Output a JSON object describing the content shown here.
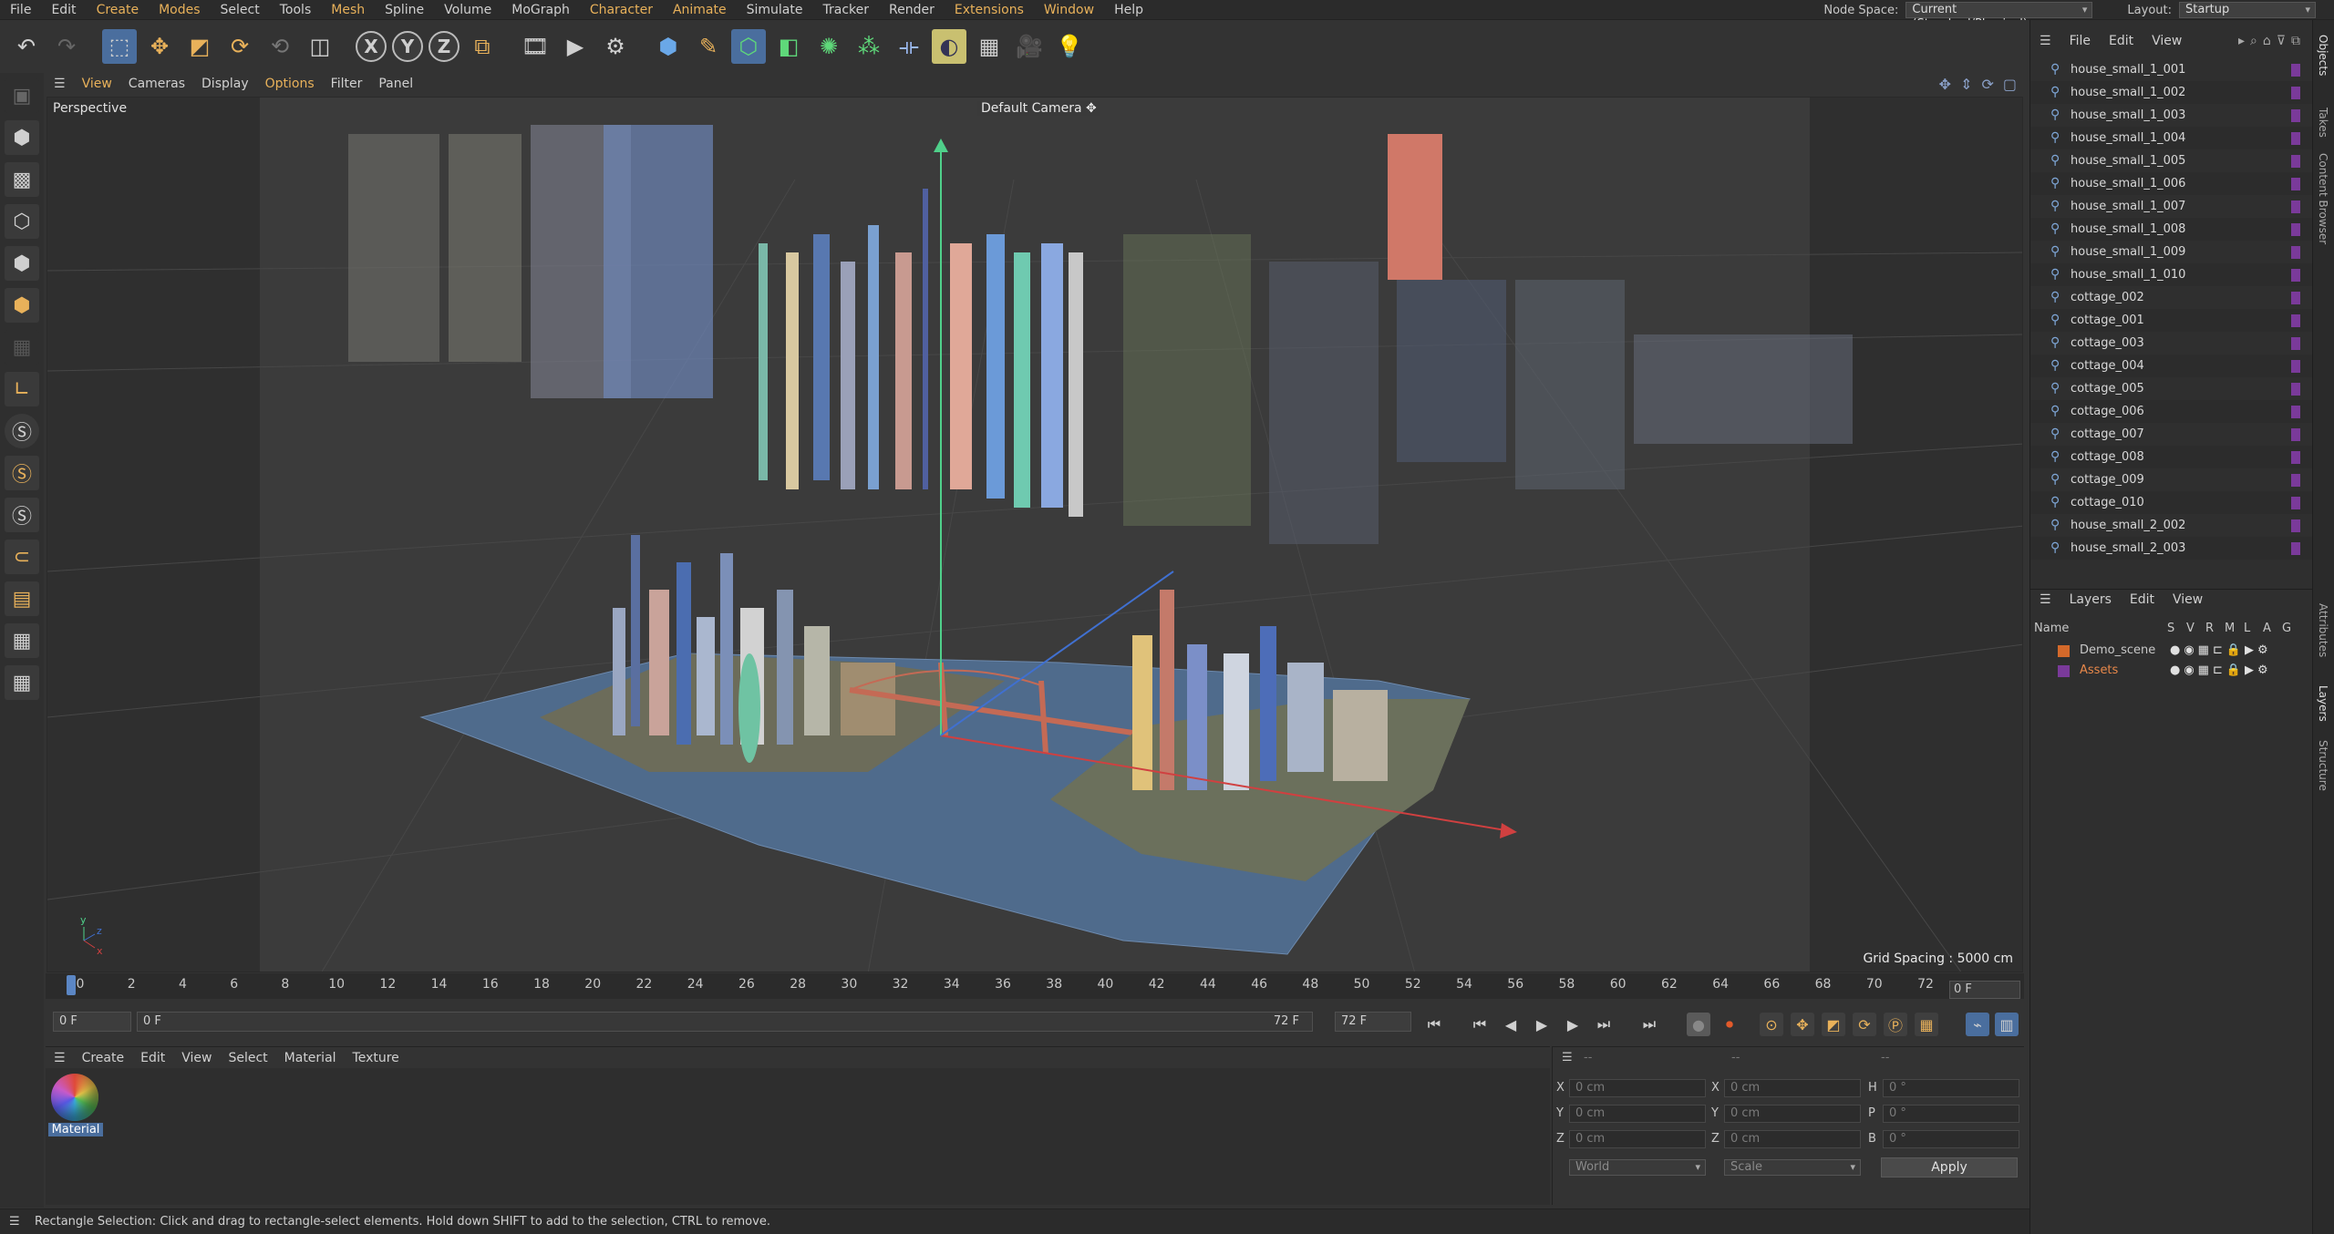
{
  "menubar": {
    "items": [
      "File",
      "Edit",
      "Create",
      "Modes",
      "Select",
      "Tools",
      "Mesh",
      "Spline",
      "Volume",
      "MoGraph",
      "Character",
      "Animate",
      "Simulate",
      "Tracker",
      "Render",
      "Extensions",
      "Window",
      "Help"
    ],
    "node_space_label": "Node Space:",
    "node_space_value": "Current (Standard/Physical)",
    "layout_label": "Layout:",
    "layout_value": "Startup"
  },
  "toolbar": {
    "icons": [
      "undo-icon",
      "redo-icon",
      "rectangle-select-icon",
      "move-icon",
      "scale-icon",
      "rotate-icon",
      "recent-tools-icon",
      "live-selection-icon",
      "x-axis-icon",
      "y-axis-icon",
      "z-axis-icon",
      "coordinate-system-icon",
      "render-region-icon",
      "render-view-icon",
      "render-settings-icon",
      "cube-icon",
      "pen-icon",
      "subdivision-icon",
      "extrude-icon",
      "cloner-icon",
      "array-icon",
      "deformer-icon",
      "field-icon",
      "floor-icon",
      "camera-icon",
      "light-icon"
    ],
    "axis_labels": [
      "X",
      "Y",
      "Z"
    ]
  },
  "viewport": {
    "menu": [
      "View",
      "Cameras",
      "Display",
      "Options",
      "Filter",
      "Panel"
    ],
    "label": "Perspective",
    "camera": "Default Camera",
    "grid_spacing": "Grid Spacing : 5000 cm"
  },
  "timeline": {
    "ticks": [
      "0",
      "2",
      "4",
      "6",
      "8",
      "10",
      "12",
      "14",
      "16",
      "18",
      "20",
      "22",
      "24",
      "26",
      "28",
      "30",
      "32",
      "34",
      "36",
      "38",
      "40",
      "42",
      "44",
      "46",
      "48",
      "50",
      "52",
      "54",
      "56",
      "58",
      "60",
      "62",
      "64",
      "66",
      "68",
      "70",
      "72"
    ],
    "frame_display": "0 F"
  },
  "transport": {
    "start_field": "0 F",
    "current_field": "0 F",
    "end_label": "72 F",
    "end_field": "72 F"
  },
  "material_manager": {
    "menu": [
      "Create",
      "Edit",
      "View",
      "Select",
      "Material",
      "Texture"
    ],
    "material_name": "Material"
  },
  "coordinates": {
    "header_left": "--",
    "header_mid": "--",
    "header_right": "--",
    "pos_labels": [
      "X",
      "Y",
      "Z"
    ],
    "pos_values": [
      "0 cm",
      "0 cm",
      "0 cm"
    ],
    "size_labels": [
      "X",
      "Y",
      "Z"
    ],
    "size_values": [
      "0 cm",
      "0 cm",
      "0 cm"
    ],
    "rot_labels": [
      "H",
      "P",
      "B"
    ],
    "rot_values": [
      "0 °",
      "0 °",
      "0 °"
    ],
    "space_select": "World",
    "mode_select": "Scale",
    "apply": "Apply"
  },
  "status": "Rectangle Selection: Click and drag to rectangle-select elements. Hold down SHIFT to add to the selection, CTRL to remove.",
  "objects": {
    "menu": [
      "File",
      "Edit",
      "View"
    ],
    "items": [
      "house_small_1_001",
      "house_small_1_002",
      "house_small_1_003",
      "house_small_1_004",
      "house_small_1_005",
      "house_small_1_006",
      "house_small_1_007",
      "house_small_1_008",
      "house_small_1_009",
      "house_small_1_010",
      "cottage_002",
      "cottage_001",
      "cottage_003",
      "cottage_004",
      "cottage_005",
      "cottage_006",
      "cottage_007",
      "cottage_008",
      "cottage_009",
      "cottage_010",
      "house_small_2_002",
      "house_small_2_003"
    ]
  },
  "layers": {
    "menu": [
      "Layers",
      "Edit",
      "View"
    ],
    "header_name": "Name",
    "header_cols": [
      "S",
      "V",
      "R",
      "M",
      "L",
      "A",
      "G"
    ],
    "rows": [
      {
        "name": "Demo_scene",
        "color": "#d4692a",
        "text_color": "#d8d8d8"
      },
      {
        "name": "Assets",
        "color": "#7a3a9a",
        "text_color": "#e8884a"
      }
    ]
  },
  "side_tabs": [
    "Objects",
    "Takes",
    "Content Browser",
    "Attributes",
    "Layers",
    "Structure"
  ]
}
